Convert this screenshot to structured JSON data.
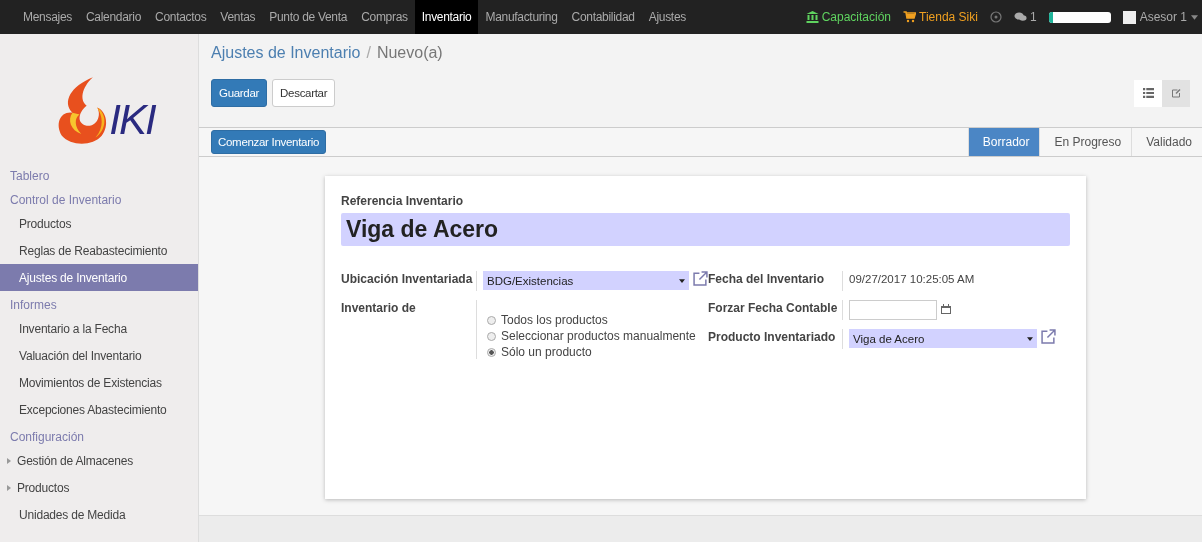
{
  "topbar": {
    "menu": [
      {
        "label": "Mensajes",
        "selected": false
      },
      {
        "label": "Calendario",
        "selected": false
      },
      {
        "label": "Contactos",
        "selected": false
      },
      {
        "label": "Ventas",
        "selected": false
      },
      {
        "label": "Punto de Venta",
        "selected": false
      },
      {
        "label": "Compras",
        "selected": false
      },
      {
        "label": "Inventario",
        "selected": true
      },
      {
        "label": "Manufacturing",
        "selected": false
      },
      {
        "label": "Contabilidad",
        "selected": false
      },
      {
        "label": "Ajustes",
        "selected": false
      }
    ],
    "training": "Capacitación",
    "shop": "Tienda Siki",
    "chat_count": "1",
    "progress": {
      "level": 0.07
    },
    "user": "Asesor 1"
  },
  "sidebar": {
    "logo_text": "IKI",
    "sections": [
      {
        "title": "Tablero"
      },
      {
        "title": "Control de Inventario",
        "items": [
          {
            "label": "Productos",
            "selected": false,
            "kind": "link"
          },
          {
            "label": "Reglas de Reabastecimiento",
            "selected": false,
            "kind": "link"
          },
          {
            "label": "Ajustes de Inventario",
            "selected": true,
            "kind": "link"
          }
        ]
      },
      {
        "title": "Informes",
        "items": [
          {
            "label": "Inventario a la Fecha",
            "selected": false,
            "kind": "link"
          },
          {
            "label": "Valuación del Inventario",
            "selected": false,
            "kind": "link"
          },
          {
            "label": "Movimientos de Existencias",
            "selected": false,
            "kind": "link"
          },
          {
            "label": "Excepciones Abastecimiento",
            "selected": false,
            "kind": "link"
          }
        ]
      },
      {
        "title": "Configuración",
        "items": [
          {
            "label": "Gestión de Almacenes",
            "selected": false,
            "kind": "group"
          },
          {
            "label": "Productos",
            "selected": false,
            "kind": "group"
          },
          {
            "label": "Unidades de Medida",
            "selected": false,
            "kind": "link"
          }
        ]
      }
    ]
  },
  "breadcrumb": {
    "parent": "Ajustes de Inventario",
    "separator": "/",
    "current": "Nuevo(a)"
  },
  "buttons": {
    "save": "Guardar",
    "discard": "Descartar"
  },
  "views": [
    {
      "kind": "list",
      "selected": false
    },
    {
      "kind": "form",
      "selected": true
    }
  ],
  "action": "Comenzar Inventario",
  "stages": [
    {
      "label": "Borrador",
      "selected": true
    },
    {
      "label": "En Progreso",
      "selected": false
    },
    {
      "label": "Validado",
      "selected": false
    }
  ],
  "form": {
    "name_label": "Referencia Inventario",
    "name": "Viga de Acero",
    "location_label": "Ubicación Inventariada",
    "location": "BDG/Existencias",
    "filter_label": "Inventario de",
    "filter_options": [
      {
        "label": "Todos los productos",
        "selected": false
      },
      {
        "label": "Seleccionar productos manualmente",
        "selected": false
      },
      {
        "label": "Sólo un producto",
        "selected": true
      }
    ],
    "date_label": "Fecha del Inventario",
    "date": "09/27/2017 10:25:05 AM",
    "accounting_date_label": "Forzar Fecha Contable",
    "product_label": "Producto Inventariado",
    "product": "Viga de Acero"
  }
}
